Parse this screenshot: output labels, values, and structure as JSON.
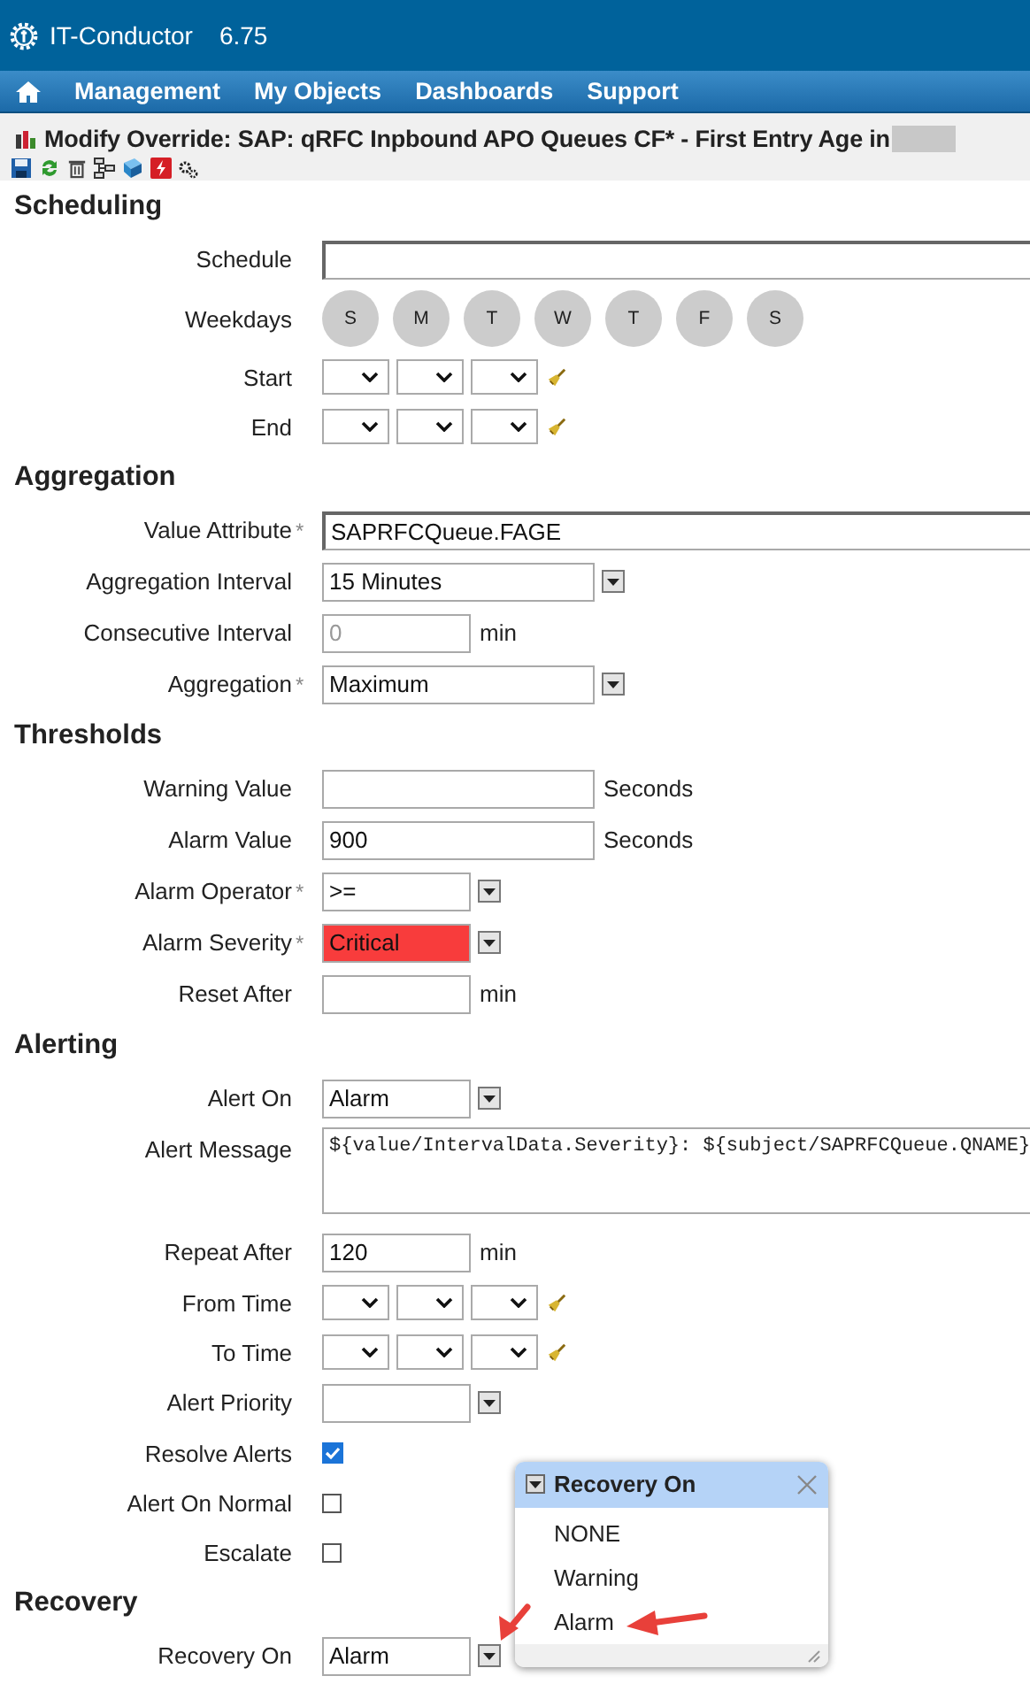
{
  "app": {
    "name": "IT-Conductor",
    "version": "6.75"
  },
  "nav": [
    "Management",
    "My Objects",
    "Dashboards",
    "Support"
  ],
  "page_title": "Modify Override: SAP: qRFC Inpbound APO Queues CF* - First Entry Age in",
  "sections": [
    {
      "title": "Scheduling",
      "fields": [
        {
          "kind": "full_text",
          "label": "Schedule"
        },
        {
          "kind": "weekdays",
          "label": "Weekdays",
          "days": [
            {
              "label": "S",
              "selected": false
            },
            {
              "label": "M",
              "selected": false
            },
            {
              "label": "T",
              "selected": false
            },
            {
              "label": "W",
              "selected": false
            },
            {
              "label": "T",
              "selected": false
            },
            {
              "label": "F",
              "selected": false
            },
            {
              "label": "S",
              "selected": false
            }
          ]
        },
        {
          "kind": "time",
          "label": "Start"
        },
        {
          "kind": "time",
          "label": "End"
        }
      ]
    },
    {
      "title": "Aggregation",
      "fields": [
        {
          "kind": "full_text",
          "label": "Value Attribute",
          "mark": "*",
          "value": "SAPRFCQueue.FAGE"
        },
        {
          "kind": "combo",
          "label": "Aggregation Interval",
          "value": "15 Minutes"
        },
        {
          "kind": "short_text",
          "label": "Consecutive Interval",
          "placeholder": "0",
          "unit": "min"
        },
        {
          "kind": "combo",
          "label": "Aggregation",
          "mark": "*",
          "value": "Maximum"
        }
      ]
    },
    {
      "title": "Thresholds",
      "fields": [
        {
          "kind": "text",
          "label": "Warning Value",
          "unit": "Seconds"
        },
        {
          "kind": "text",
          "label": "Alarm Value",
          "value": "900",
          "unit": "Seconds"
        },
        {
          "kind": "short_combo",
          "label": "Alarm Operator",
          "mark": "*",
          "value": ">="
        },
        {
          "kind": "short_combo",
          "label": "Alarm Severity",
          "mark": "*",
          "value": "Critical",
          "color": "#f83c3c"
        },
        {
          "kind": "short_text",
          "label": "Reset After",
          "unit": "min"
        }
      ]
    },
    {
      "title": "Alerting",
      "fields": [
        {
          "kind": "short_combo",
          "label": "Alert On",
          "value": "Alarm"
        },
        {
          "kind": "textarea",
          "label": "Alert Message",
          "value": "${value/IntervalData.Severity}: ${subject/SAPRFCQueue.QNAME}"
        },
        {
          "kind": "short_text",
          "label": "Repeat After",
          "value": "120",
          "unit": "min"
        },
        {
          "kind": "time",
          "label": "From Time"
        },
        {
          "kind": "time",
          "label": "To Time"
        },
        {
          "kind": "short_combo",
          "label": "Alert Priority"
        },
        {
          "kind": "checkbox",
          "label": "Resolve Alerts",
          "checked": true
        },
        {
          "kind": "checkbox",
          "label": "Alert On Normal",
          "checked": false
        },
        {
          "kind": "checkbox",
          "label": "Escalate",
          "checked": false
        }
      ]
    },
    {
      "title": "Recovery",
      "fields": [
        {
          "kind": "short_combo",
          "label": "Recovery On",
          "value": "Alarm"
        }
      ]
    }
  ],
  "popup": {
    "title": "Recovery On",
    "options": [
      {
        "label": "NONE",
        "selected": false
      },
      {
        "label": "Warning",
        "selected": false
      },
      {
        "label": "Alarm",
        "selected": false
      }
    ]
  }
}
